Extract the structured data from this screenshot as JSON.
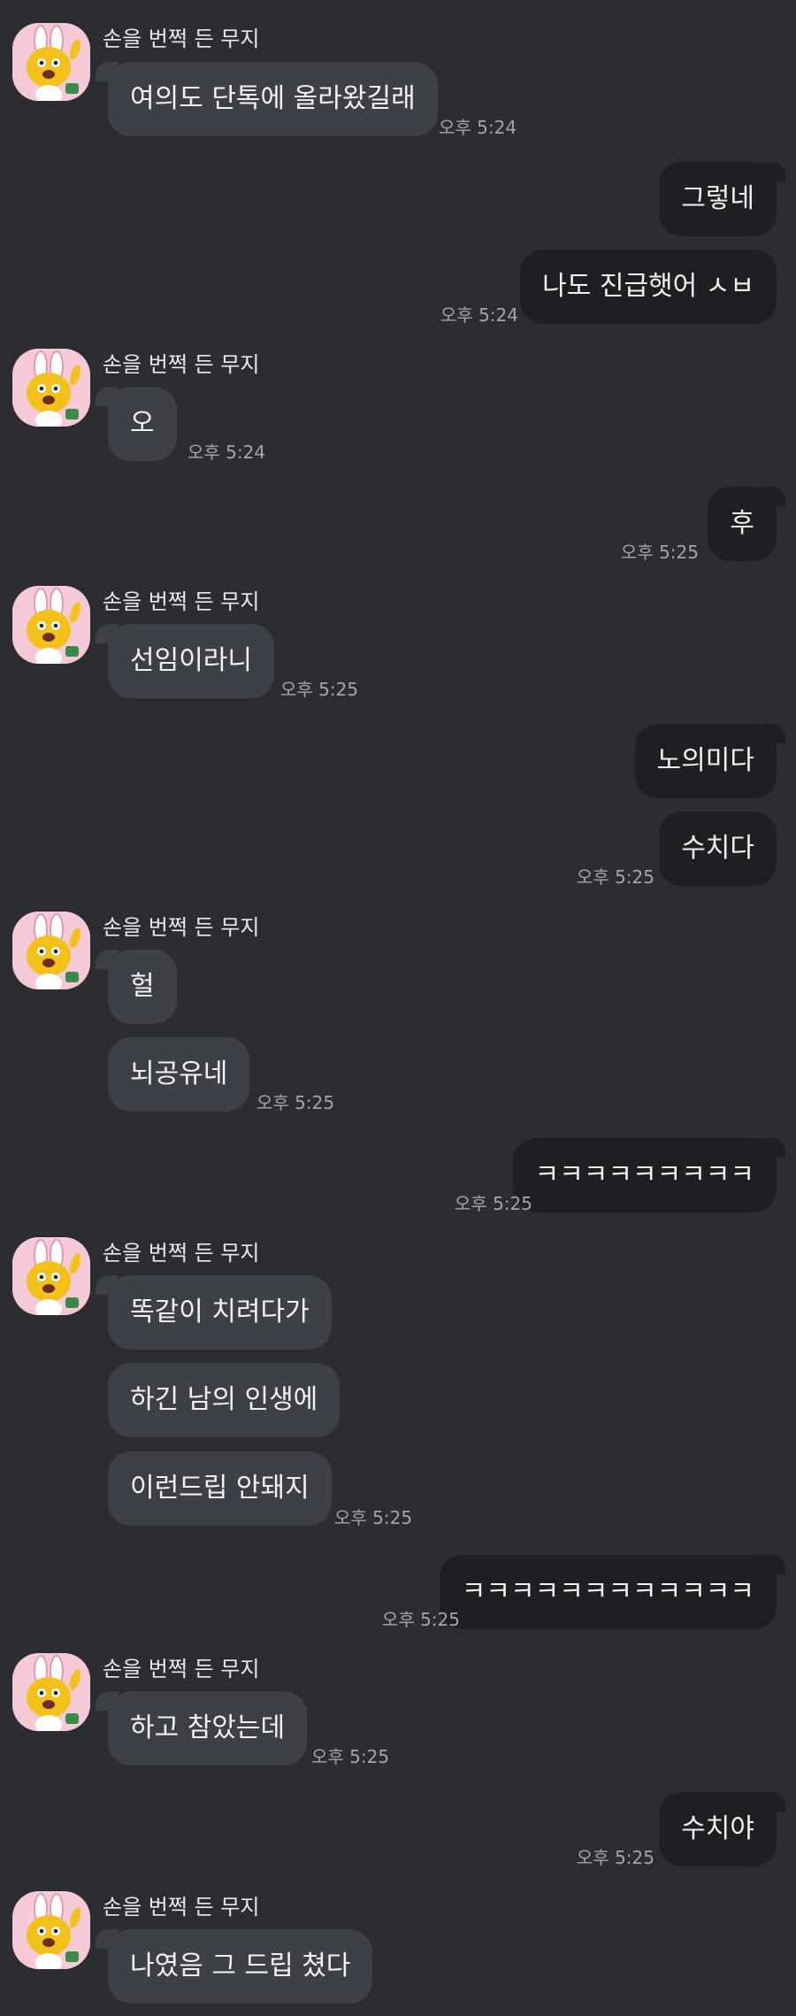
{
  "sender_name": "손을 번쩍 든 무지",
  "messages": [
    {
      "text": "여의도 단톡에 올라왔길래",
      "time": "오후 5:24"
    },
    {
      "text": "그렇네"
    },
    {
      "text": "나도 진급햇어 ㅅㅂ",
      "time": "오후 5:24"
    },
    {
      "text": "오",
      "time": "오후 5:24"
    },
    {
      "text": "후",
      "time": "오후 5:25"
    },
    {
      "text": "선임이라니",
      "time": "오후 5:25"
    },
    {
      "text": "노의미다"
    },
    {
      "text": "수치다",
      "time": "오후 5:25"
    },
    {
      "text": "헐"
    },
    {
      "text": "뇌공유네",
      "time": "오후 5:25"
    },
    {
      "text": "ㅋㅋㅋㅋㅋㅋㅋㅋㅋ",
      "time": "오후 5:25"
    },
    {
      "text": "똑같이 치려다가"
    },
    {
      "text": "하긴 남의 인생에"
    },
    {
      "text": "이런드립 안돼지",
      "time": "오후 5:25"
    },
    {
      "text": "ㅋㅋㅋㅋㅋㅋㅋㅋㅋㅋㅋㅋ",
      "time": "오후 5:25"
    },
    {
      "text": "하고 참았는데",
      "time": "오후 5:25"
    },
    {
      "text": "수치야",
      "time": "오후 5:25"
    },
    {
      "text": "나였음 그 드립 쳤다"
    }
  ]
}
